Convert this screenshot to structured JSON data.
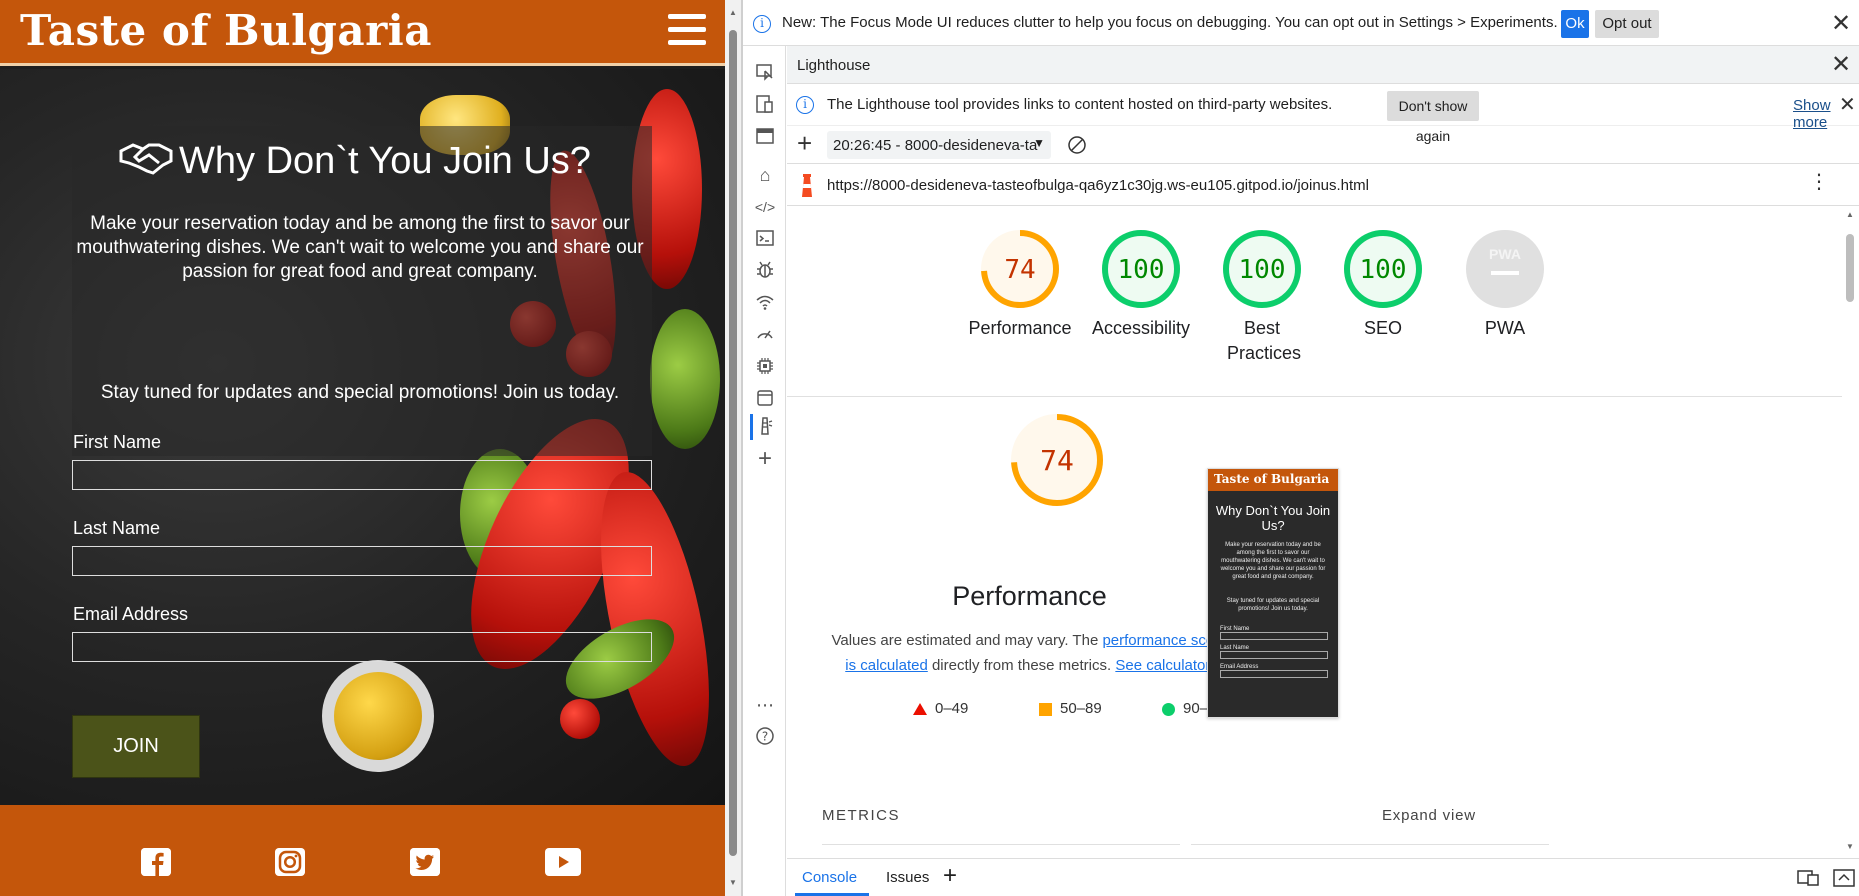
{
  "site": {
    "brand": "Taste of Bulgaria",
    "title": "Why Don`t You Join Us?",
    "intro": "Make your reservation today and be among the first to savor our mouthwatering dishes. We can't wait to welcome you and share our passion for great food and great company.",
    "promo": "Stay tuned for updates and special promotions! Join us today.",
    "form": {
      "first_name_label": "First Name",
      "last_name_label": "Last Name",
      "email_label": "Email Address",
      "first_name_value": "",
      "last_name_value": "",
      "email_value": "",
      "submit_label": "JOIN"
    },
    "social": [
      "facebook-icon",
      "instagram-icon",
      "twitter-icon",
      "youtube-icon"
    ]
  },
  "devtools": {
    "banner": {
      "message": "New: The Focus Mode UI reduces clutter to help you focus on debugging. You can opt out in Settings > Experiments.",
      "ok_label": "Ok",
      "optout_label": "Opt out"
    },
    "panel_title": "Lighthouse",
    "info": {
      "message": "The Lighthouse tool provides links to content hosted on third-party websites.",
      "dont_show_label": "Don't show again",
      "show_more_label": "Show more"
    },
    "report_select": "20:26:45 - 8000-desideneva-ta",
    "url": "https://8000-desideneva-tasteofbulga-qa6yz1c30jg.ws-eu105.gitpod.io/joinus.html",
    "scores": [
      {
        "label": "Performance",
        "value": "74",
        "fraction": 0.74,
        "color": "#ffa400",
        "text_color": "#c33300",
        "fill": "#fff8ec"
      },
      {
        "label": "Accessibility",
        "value": "100",
        "fraction": 1.0,
        "color": "#0cce6b",
        "text_color": "#008800",
        "fill": "#eefbf2"
      },
      {
        "label": "Best Practices",
        "value": "100",
        "fraction": 1.0,
        "color": "#0cce6b",
        "text_color": "#008800",
        "fill": "#eefbf2"
      },
      {
        "label": "SEO",
        "value": "100",
        "fraction": 1.0,
        "color": "#0cce6b",
        "text_color": "#008800",
        "fill": "#eefbf2"
      },
      {
        "label": "PWA",
        "value": "",
        "fraction": 0,
        "color": "#e0e0e0",
        "text_color": "#9e9e9e",
        "fill": "#e0e0e0"
      }
    ],
    "pwa_badge": "PWA",
    "performance": {
      "score": "74",
      "title": "Performance",
      "desc_prefix": "Values are estimated and may vary. The ",
      "desc_link1": "performance score is calculated",
      "desc_mid": " directly from these metrics. ",
      "desc_link2": "See calculator."
    },
    "legend": [
      "0–49",
      "50–89",
      "90–100"
    ],
    "metrics_label": "METRICS",
    "expand_label": "Expand view",
    "drawer_tabs": [
      "Console",
      "Issues"
    ],
    "thumbnail": {
      "title": "Taste of Bulgaria",
      "heading": "Why Don`t You Join Us?",
      "intro": "Make your reservation today and be among the first to savor our mouthwatering dishes. We can't wait to welcome you and share our passion for great food and great company.",
      "promo": "Stay tuned for updates and special promotions! Join us today.",
      "fields": [
        "First Name",
        "Last Name",
        "Email Address"
      ]
    }
  }
}
